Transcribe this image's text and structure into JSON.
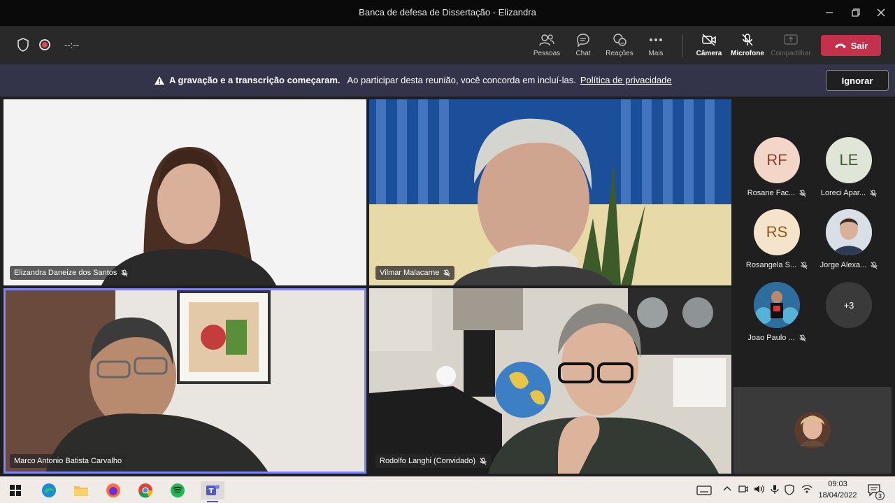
{
  "window": {
    "title": "Banca de defesa de Dissertação - Elizandra"
  },
  "toolbar": {
    "timer": "--:--",
    "items": [
      {
        "label": "Pessoas",
        "icon": "people-icon"
      },
      {
        "label": "Chat",
        "icon": "chat-icon"
      },
      {
        "label": "Reações",
        "icon": "reactions-icon"
      },
      {
        "label": "Mais",
        "icon": "more-icon"
      },
      {
        "label": "Câmera",
        "icon": "camera-off-icon"
      },
      {
        "label": "Microfone",
        "icon": "mic-off-icon"
      },
      {
        "label": "Compartilhar",
        "icon": "share-icon"
      }
    ],
    "leave_label": "Sair"
  },
  "banner": {
    "bold_text": "A gravação e a transcrição começaram.",
    "text": "Ao participar desta reunião, você concorda em incluí-las.",
    "link_text": "Política de privacidade",
    "ignore_label": "Ignorar"
  },
  "tiles": [
    {
      "name": "Elizandra Daneize dos Santos"
    },
    {
      "name": "Vilmar Malacarne"
    },
    {
      "name": "Marco Antonio Batista Carvalho"
    },
    {
      "name": "Rodolfo Langhi (Convidado)"
    }
  ],
  "participants": [
    {
      "initials": "RF",
      "name": "Rosane Fac...",
      "color": "#f4d6c8"
    },
    {
      "initials": "LE",
      "name": "Loreci Apar...",
      "color": "#dfe6d8"
    },
    {
      "initials": "RS",
      "name": "Rosangela S...",
      "color": "#f5e3cc"
    },
    {
      "initials": "",
      "name": "Jorge Alexa...",
      "color": "#c9d4e0"
    },
    {
      "initials": "",
      "name": "Joao Paulo ...",
      "color": "#2f5f8a"
    },
    {
      "initials": "+3",
      "name": "",
      "color": "#3a3a3a"
    }
  ],
  "taskbar": {
    "time": "09:03",
    "date": "18/04/2022",
    "notification_count": "3"
  }
}
